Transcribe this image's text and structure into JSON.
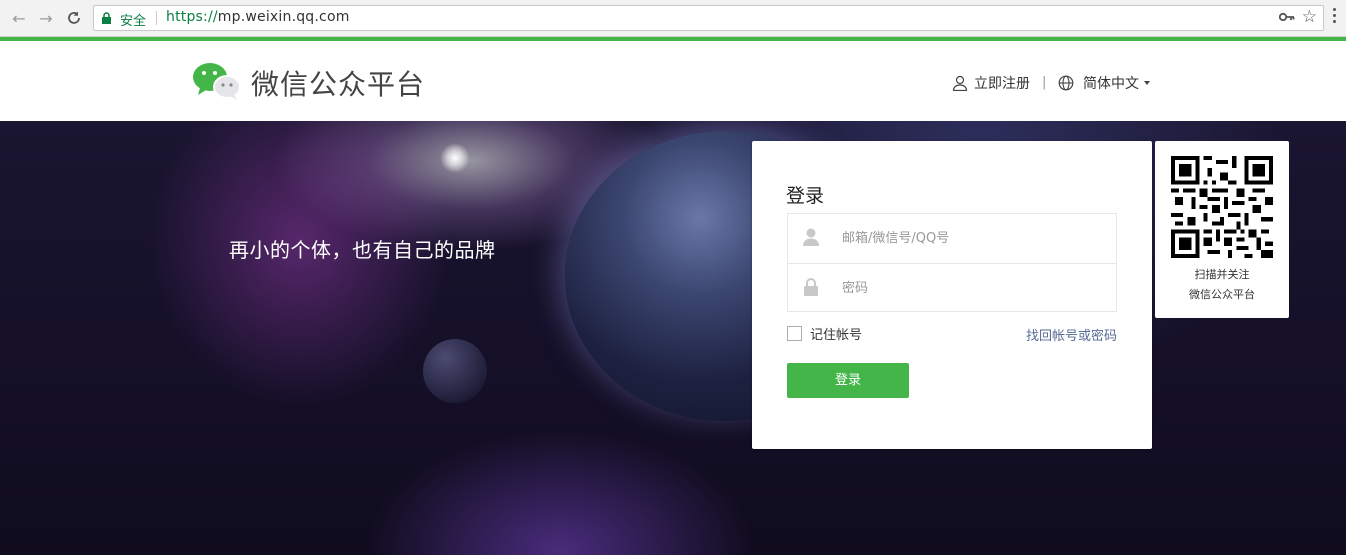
{
  "browser": {
    "security_label": "安全",
    "url_protocol": "https://",
    "url_host": "mp.weixin.qq.com"
  },
  "header": {
    "brand": "微信公众平台",
    "register_label": "立即注册",
    "separator": "|",
    "language_label": "简体中文"
  },
  "banner": {
    "slogan": "再小的个体，也有自己的品牌"
  },
  "login": {
    "title": "登录",
    "account_placeholder": "邮箱/微信号/QQ号",
    "password_placeholder": "密码",
    "remember_label": "记住帐号",
    "forgot_label": "找回帐号或密码",
    "submit_label": "登录"
  },
  "qr": {
    "line1": "扫描并关注",
    "line2": "微信公众平台"
  },
  "colors": {
    "brand_green": "#44b549",
    "link_blue": "#576b95",
    "secure_green": "#0b8043"
  }
}
